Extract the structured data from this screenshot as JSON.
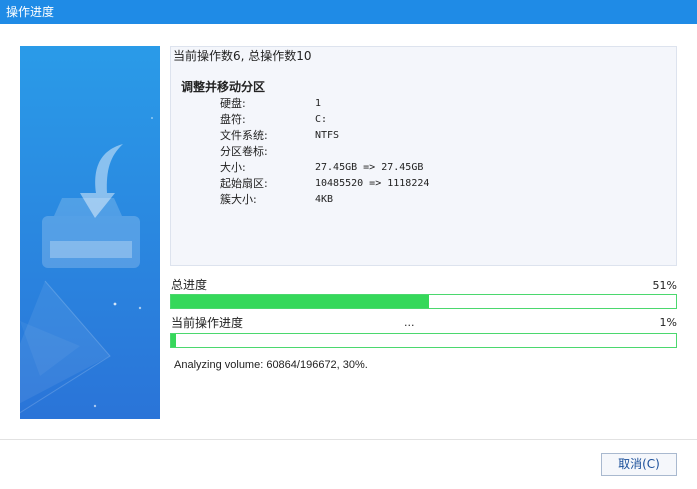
{
  "window": {
    "title": "操作进度"
  },
  "operation": {
    "summary": "当前操作数6, 总操作数10",
    "title": "调整并移动分区",
    "details": [
      {
        "key": "硬盘:",
        "value": "1"
      },
      {
        "key": "盘符:",
        "value": "C:"
      },
      {
        "key": "文件系统:",
        "value": "NTFS"
      },
      {
        "key": "分区卷标:",
        "value": ""
      },
      {
        "key": "大小:",
        "value": "27.45GB => 27.45GB"
      },
      {
        "key": "起始扇区:",
        "value": "10485520 => 1118224"
      },
      {
        "key": "簇大小:",
        "value": "4KB"
      }
    ]
  },
  "progress": {
    "total": {
      "label": "总进度",
      "percent_text": "51%",
      "value": 0.51
    },
    "current": {
      "label": "当前操作进度",
      "middle_text": "...",
      "percent_text": "1%",
      "value": 0.01
    }
  },
  "status": "Analyzing volume: 60864/196672, 30%.",
  "buttons": {
    "cancel": "取消(C)"
  },
  "colors": {
    "titlebar": "#1f8be6",
    "progress_fill": "#35d85a",
    "banner_top": "#2a9be8",
    "banner_bottom": "#2a74d8"
  },
  "icons": {
    "banner": "download-into-drive-icon"
  }
}
